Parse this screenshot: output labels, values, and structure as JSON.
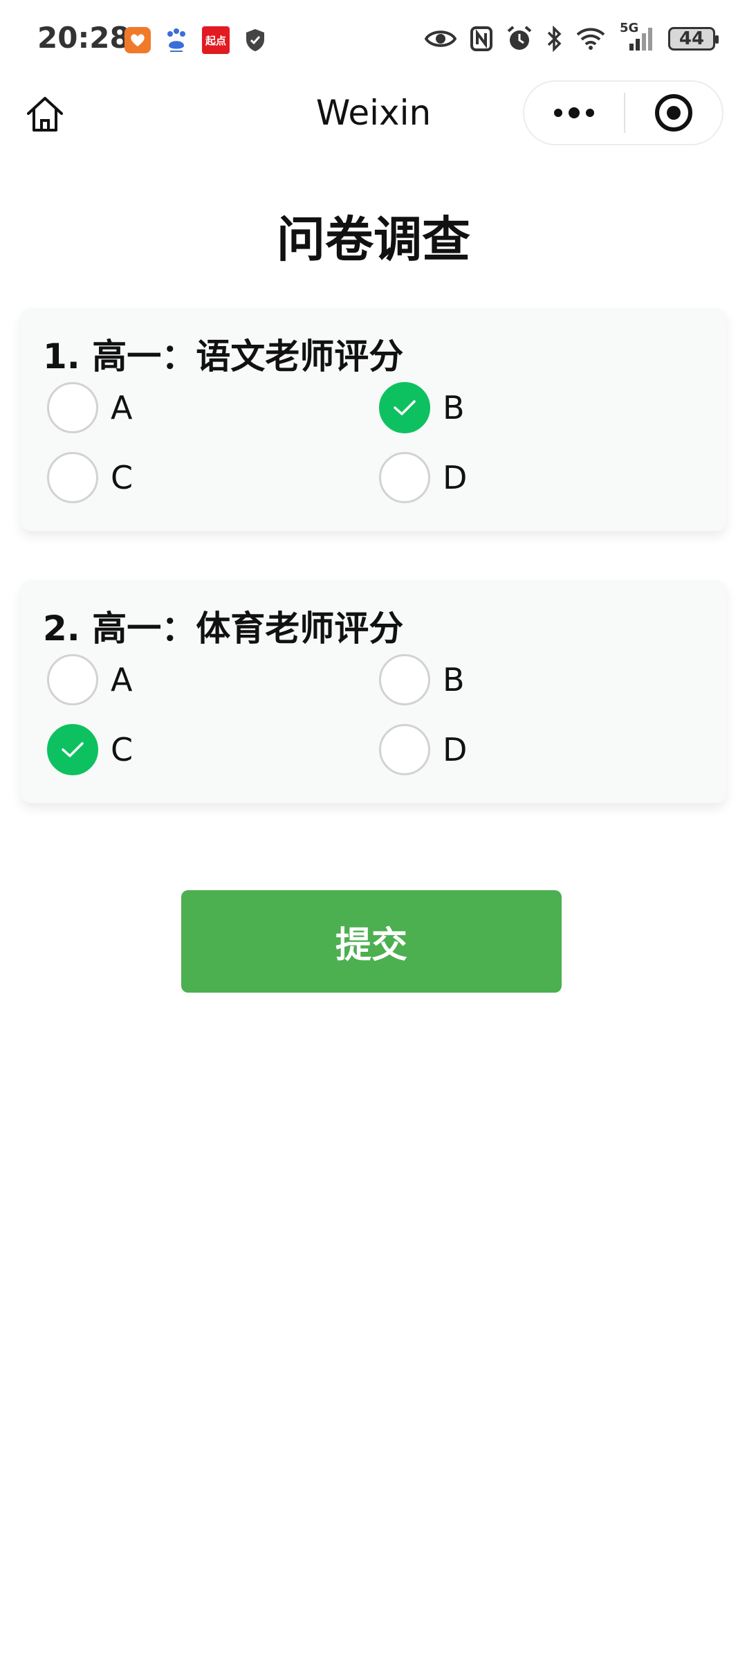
{
  "status_bar": {
    "time": "20:28",
    "battery": "44",
    "notification_icons": [
      "taobao-icon",
      "baidu-icon",
      "qidian-icon",
      "shield-icon"
    ],
    "qidian_text": "起点",
    "system_icons": [
      "eye-icon",
      "nfc-icon",
      "alarm-icon",
      "bluetooth-icon",
      "wifi-icon",
      "signal-5g-icon"
    ],
    "network": "5G"
  },
  "nav": {
    "title": "Weixin"
  },
  "page": {
    "title": "问卷调查"
  },
  "questions": [
    {
      "text": "1. 高一：语文老师评分",
      "options": [
        {
          "label": "A",
          "checked": false
        },
        {
          "label": "B",
          "checked": true
        },
        {
          "label": "C",
          "checked": false
        },
        {
          "label": "D",
          "checked": false
        }
      ]
    },
    {
      "text": "2. 高一：体育老师评分",
      "options": [
        {
          "label": "A",
          "checked": false
        },
        {
          "label": "B",
          "checked": false
        },
        {
          "label": "C",
          "checked": true
        },
        {
          "label": "D",
          "checked": false
        }
      ]
    }
  ],
  "submit": {
    "label": "提交"
  },
  "colors": {
    "checked": "#0ec160",
    "submit_bg": "#4caf50"
  }
}
